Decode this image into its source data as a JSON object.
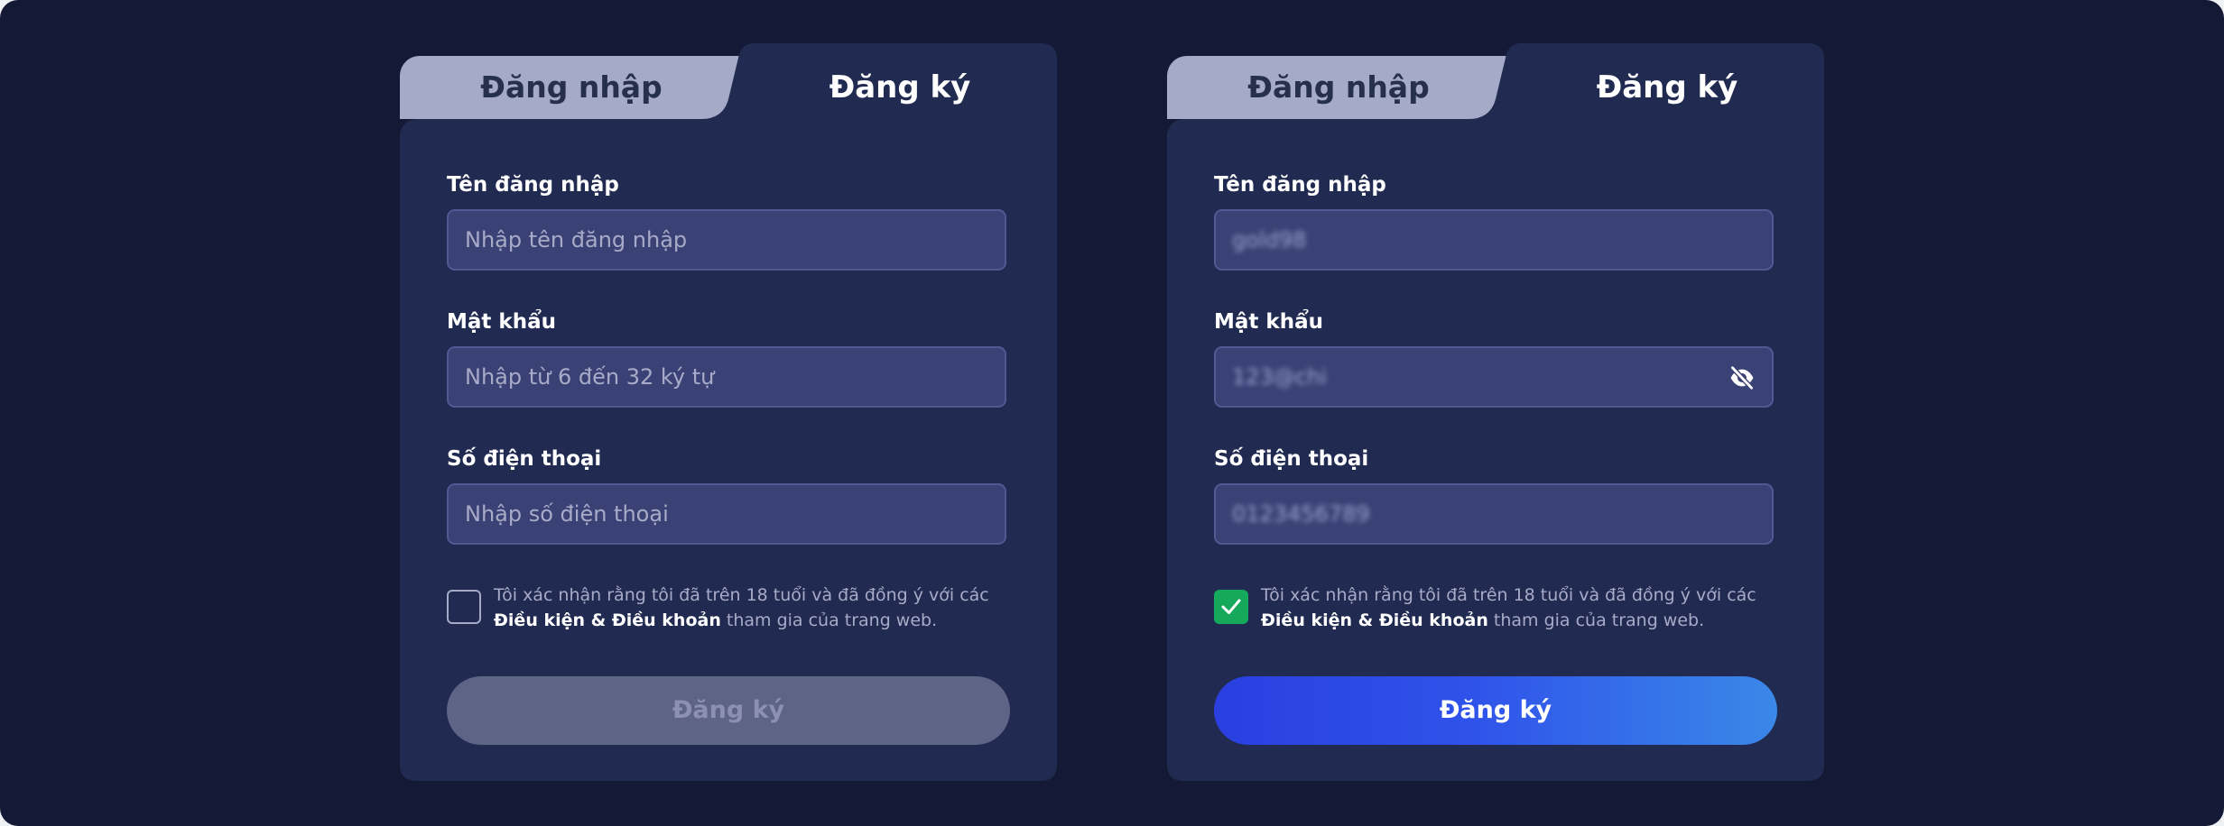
{
  "forms": [
    {
      "tabs": {
        "login": "Đăng nhập",
        "register": "Đăng ký"
      },
      "username": {
        "label": "Tên đăng nhập",
        "placeholder": "Nhập tên đăng nhập",
        "value": ""
      },
      "password": {
        "label": "Mật khẩu",
        "placeholder": "Nhập từ 6 đến 32 ký tự",
        "value": ""
      },
      "phone": {
        "label": "Số điện thoại",
        "placeholder": "Nhập số điện thoại",
        "value": ""
      },
      "terms": {
        "checked": false,
        "text_before": "Tôi xác nhận rằng tôi đã trên 18 tuổi và đã đồng ý với các ",
        "link": "Điều kiện & Điều khoản",
        "text_after": " tham gia của trang web."
      },
      "submit": {
        "label": "Đăng ký",
        "state": "disabled"
      }
    },
    {
      "tabs": {
        "login": "Đăng nhập",
        "register": "Đăng ký"
      },
      "username": {
        "label": "Tên đăng nhập",
        "placeholder": "",
        "value": "gold98"
      },
      "password": {
        "label": "Mật khẩu",
        "placeholder": "",
        "value": "123@chi",
        "icon": "eye-slash-icon"
      },
      "phone": {
        "label": "Số điện thoại",
        "placeholder": "",
        "value": "0123456789"
      },
      "terms": {
        "checked": true,
        "text_before": "Tôi xác nhận rằng tôi đã trên 18 tuổi và đã đồng ý với các ",
        "link": "Điều kiện & Điều khoản",
        "text_after": " tham gia của trang web."
      },
      "submit": {
        "label": "Đăng ký",
        "state": "enabled"
      }
    }
  ],
  "colors": {
    "background": "#141a36",
    "panel": "#212a50",
    "inactive_tab": "#a6aac9",
    "input_bg": "#3a4275",
    "checkbox_checked": "#16a85b",
    "button_disabled": "#5d6486",
    "button_gradient_start": "#2a3fe0",
    "button_gradient_end": "#3a88e8"
  }
}
